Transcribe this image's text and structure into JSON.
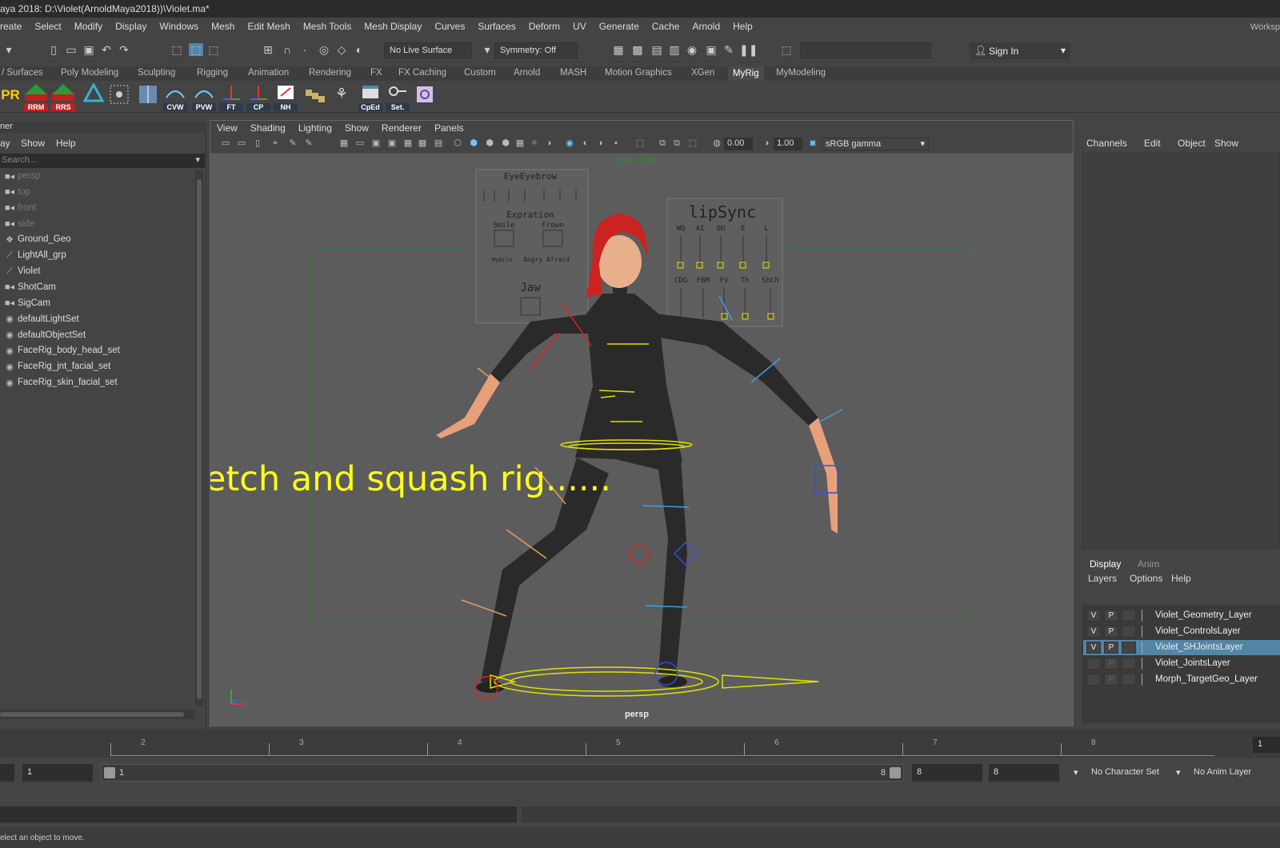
{
  "title": "aya 2018: D:\\Violet(ArnoldMaya2018))\\Violet.ma*",
  "menu": [
    "reate",
    "Select",
    "Modify",
    "Display",
    "Windows",
    "Mesh",
    "Edit Mesh",
    "Mesh Tools",
    "Mesh Display",
    "Curves",
    "Surfaces",
    "Deform",
    "UV",
    "Generate",
    "Cache",
    "Arnold",
    "Help"
  ],
  "workspace_label": "Worksp",
  "status_line": {
    "live_surface": "No Live Surface",
    "symmetry": "Symmetry: Off",
    "sign_in": "Sign In"
  },
  "shelf_tabs": [
    "/ Surfaces",
    "Poly Modeling",
    "Sculpting",
    "Rigging",
    "Animation",
    "Rendering",
    "FX",
    "FX Caching",
    "Custom",
    "Arnold",
    "MASH",
    "Motion Graphics",
    "XGen",
    "MyRig",
    "MyModeling"
  ],
  "active_shelf_tab": "MyRig",
  "shelf_buttons": [
    "PR",
    "RRM",
    "RRS",
    "CVW",
    "PVW",
    "FT",
    "CP",
    "NH",
    "CpEd",
    "Set."
  ],
  "outliner": {
    "title": "ner",
    "menu": [
      "ay",
      "Show",
      "Help"
    ],
    "search_placeholder": "Search...",
    "items": [
      {
        "label": "persp",
        "icon": "camera-icon",
        "dim": true
      },
      {
        "label": "top",
        "icon": "camera-icon",
        "dim": true
      },
      {
        "label": "front",
        "icon": "camera-icon",
        "dim": true
      },
      {
        "label": "side",
        "icon": "camera-icon",
        "dim": true
      },
      {
        "label": "Ground_Geo",
        "icon": "mesh-icon",
        "dim": false
      },
      {
        "label": "LightAll_grp",
        "icon": "group-icon",
        "dim": false
      },
      {
        "label": "Violet",
        "icon": "group-icon",
        "dim": false
      },
      {
        "label": "ShotCam",
        "icon": "camera-icon",
        "dim": false
      },
      {
        "label": "SigCam",
        "icon": "camera-icon",
        "dim": false
      },
      {
        "label": "defaultLightSet",
        "icon": "set-icon",
        "dim": false
      },
      {
        "label": "defaultObjectSet",
        "icon": "set-icon",
        "dim": false
      },
      {
        "label": "FaceRig_body_head_set",
        "icon": "set-icon",
        "dim": false
      },
      {
        "label": "FaceRig_jnt_facial_set",
        "icon": "set-icon",
        "dim": false
      },
      {
        "label": "FaceRig_skin_facial_set",
        "icon": "set-icon",
        "dim": false
      }
    ]
  },
  "viewport": {
    "menu": [
      "View",
      "Shading",
      "Lighting",
      "Show",
      "Renderer",
      "Panels"
    ],
    "near_value": "0.00",
    "gamma_value": "1.00",
    "color_space": "sRGB gamma",
    "resolution_label": "1920 x 1080",
    "camera_label": "persp",
    "overlay_text": "Stretch and squash rig......",
    "eye_panel": {
      "title": "EyeEyebrow",
      "sub1": "Expration",
      "smile": "Smile",
      "frown": "Frown",
      "jaw": "Jaw",
      "angry": "Angry Afraid",
      "mymile": "Mymile"
    },
    "lip_panel": {
      "title": "lipSync",
      "top": [
        "WQ",
        "AI",
        "OU",
        "E",
        "L"
      ],
      "bottom": [
        "CDG",
        "FBM",
        "FV",
        "Th",
        "ShCh"
      ]
    }
  },
  "channel_box": {
    "menu": [
      "Channels",
      "Edit",
      "Object",
      "Show"
    ]
  },
  "layer_editor": {
    "tabs": [
      "Display",
      "Anim"
    ],
    "menu": [
      "Layers",
      "Options",
      "Help"
    ],
    "layers": [
      {
        "v": "V",
        "p": "P",
        "name": "Violet_Geometry_Layer",
        "selected": false
      },
      {
        "v": "V",
        "p": "P",
        "name": "Violet_ControlsLayer",
        "selected": false
      },
      {
        "v": "V",
        "p": "P",
        "name": "Violet_SHJointsLayer",
        "selected": true
      },
      {
        "v": "",
        "p": "P",
        "name": "Violet_JointsLayer",
        "selected": false
      },
      {
        "v": "",
        "p": "P",
        "name": "Morph_TargetGeo_Layer",
        "selected": false
      }
    ]
  },
  "time_slider": {
    "ticks": [
      "2",
      "3",
      "4",
      "5",
      "6",
      "7",
      "8"
    ],
    "current_frame": "1"
  },
  "range_slider": {
    "start": "1",
    "range_start": "1",
    "range_end": "8",
    "end": "8",
    "end2": "8",
    "character_set": "No Character Set",
    "anim_layer": "No Anim Layer"
  },
  "help_line": "elect an object to move.",
  "colors": {
    "overlay_text": "#ffff1a",
    "selection": "#5285a6",
    "resolution_gate": "#3d7a3d"
  }
}
